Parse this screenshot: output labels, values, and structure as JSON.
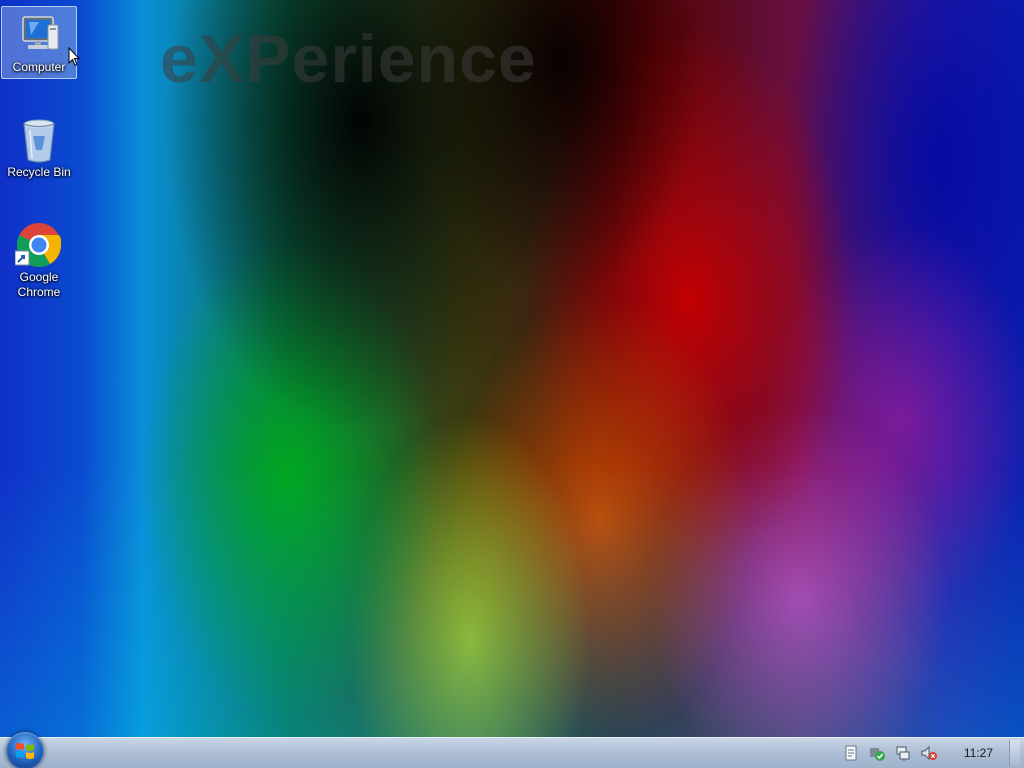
{
  "wallpaper": {
    "watermark_text": "eXPerience"
  },
  "desktop_icons": [
    {
      "label": "Computer",
      "icon": "computer-icon",
      "selected": true
    },
    {
      "label": "Recycle Bin",
      "icon": "recycle-bin-icon",
      "selected": false
    },
    {
      "label": "Google\nChrome",
      "icon": "google-chrome-icon",
      "selected": false
    }
  ],
  "taskbar": {
    "start_icon": "windows-logo-icon",
    "tray_icons": [
      "action-center-icon",
      "security-icon",
      "network-icon",
      "volume-muted-icon"
    ],
    "clock": "11:27"
  }
}
